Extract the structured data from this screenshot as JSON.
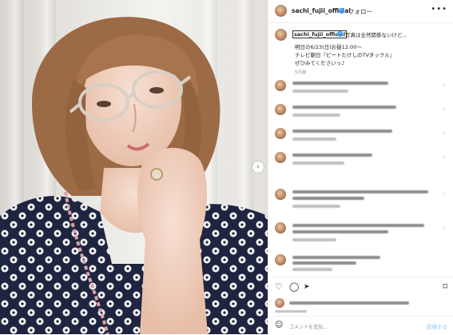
{
  "post": {
    "username": "sachi_fujii_official",
    "follow_label": "フォロー",
    "more_label": "•••",
    "verified_mark": "✓",
    "carousel_next": "›"
  },
  "caption": {
    "username": "sachi_fujii_official",
    "text": "写真は全然関係ないけど...",
    "lines": [
      "明日の6/23(日)お昼12:00〜",
      "テレビ朝日『ビートたけしのTVタックル』",
      "ぜひみてくださいっ♪"
    ],
    "time": "5日前"
  },
  "actions": {
    "like_icon": "heart-icon",
    "comment_icon": "comment-icon",
    "share_icon": "share-icon",
    "save_icon": "bookmark-icon",
    "like_glyph": "♡",
    "comment_glyph": "◯",
    "share_glyph": "➤",
    "save_glyph": "⌑"
  },
  "add_comment": {
    "emoji_glyph": "☺",
    "placeholder": "コメントを追加...",
    "post_label": "投稿する"
  },
  "colors": {
    "verified": "#3897f0",
    "post_button": "#b3dbff"
  }
}
